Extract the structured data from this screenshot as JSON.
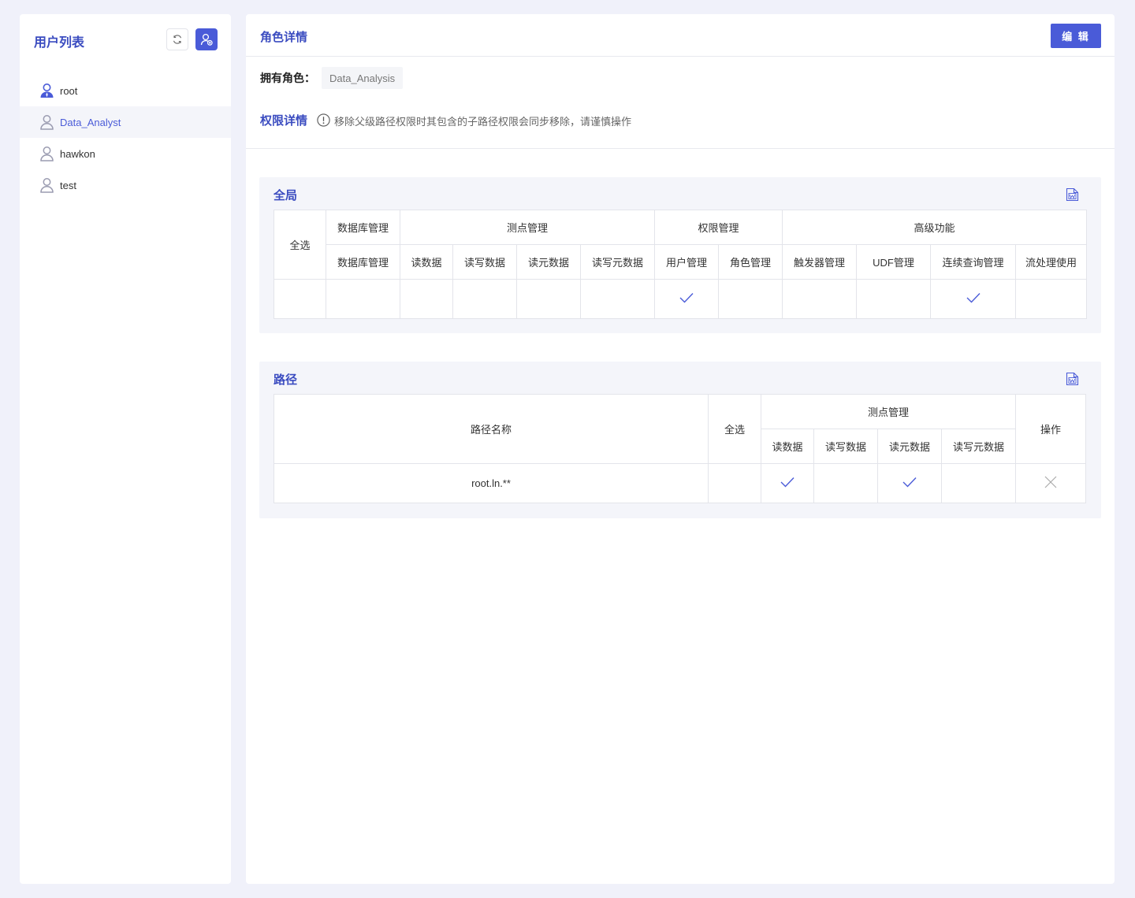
{
  "sidebar": {
    "title": "用户列表",
    "users": [
      {
        "name": "root",
        "icon": "user-admin-icon",
        "active": false
      },
      {
        "name": "Data_Analyst",
        "icon": "user-icon",
        "active": true
      },
      {
        "name": "hawkon",
        "icon": "user-icon",
        "active": false
      },
      {
        "name": "test",
        "icon": "user-icon",
        "active": false
      }
    ]
  },
  "main": {
    "title": "角色详情",
    "edit_label": "编 辑",
    "role_label": "拥有角色：",
    "role_value": "Data_Analysis",
    "perm_title": "权限详情",
    "perm_note": "移除父级路径权限时其包含的子路径权限会同步移除，请谨慎操作"
  },
  "global": {
    "title": "全局",
    "select_all": "全选",
    "groups": [
      "数据库管理",
      "测点管理",
      "权限管理",
      "高级功能"
    ],
    "columns": [
      "数据库管理",
      "读数据",
      "读写数据",
      "读元数据",
      "读写元数据",
      "用户管理",
      "角色管理",
      "触发器管理",
      "UDF管理",
      "连续查询管理",
      "流处理使用"
    ],
    "checked": [
      false,
      false,
      false,
      false,
      false,
      true,
      false,
      false,
      false,
      true,
      false
    ]
  },
  "path": {
    "title": "路径",
    "name_header": "路径名称",
    "select_all": "全选",
    "group": "测点管理",
    "action_header": "操作",
    "columns": [
      "读数据",
      "读写数据",
      "读元数据",
      "读写元数据"
    ],
    "rows": [
      {
        "name": "root.ln.**",
        "checked": [
          true,
          false,
          true,
          false
        ]
      }
    ]
  },
  "colors": {
    "accent": "#4a5bd8",
    "title": "#3b4cc0",
    "background": "#f0f1fa"
  }
}
